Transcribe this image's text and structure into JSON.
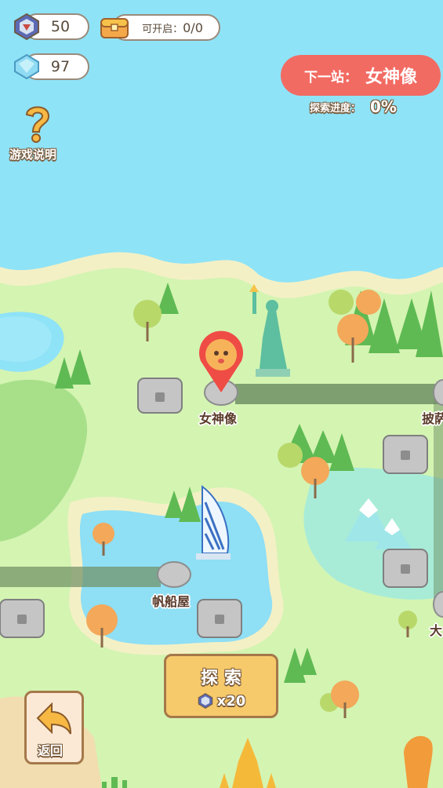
{
  "currency": {
    "tickets": "50",
    "gems": "97"
  },
  "chest_counter": {
    "label": "可开启：",
    "value": "0/0"
  },
  "help": {
    "label": "游戏说明"
  },
  "next_stop": {
    "prefix": "下一站：",
    "name": "女神像"
  },
  "progress": {
    "label": "探索进度：",
    "value": "0%"
  },
  "nodes": {
    "statue": "女神像",
    "sail": "帆船屋",
    "right_top": "披萨",
    "right_bottom": "大"
  },
  "explore": {
    "label": "探 索",
    "cost": "x20"
  },
  "back": {
    "label": "返回"
  },
  "colors": {
    "sea": "#8fe3f7",
    "land": "#d4f4b2",
    "path": "#6e8f63",
    "accent": "#f26b63",
    "button": "#f6c96b"
  }
}
